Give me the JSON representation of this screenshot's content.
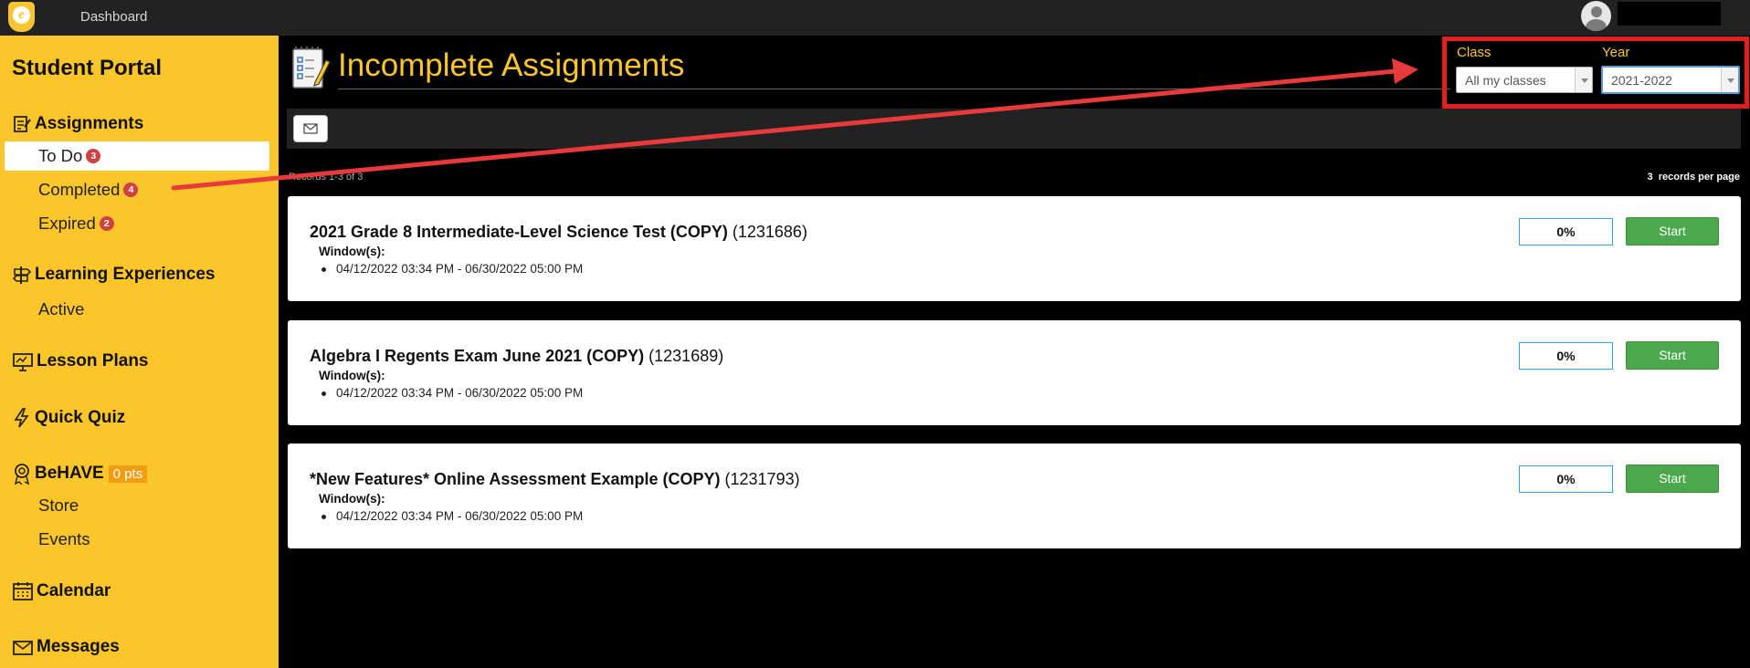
{
  "topbar": {
    "nav_label": "Dashboard"
  },
  "sidebar": {
    "title": "Student Portal",
    "sections": [
      {
        "label": "Assignments",
        "icon": "assignments-icon",
        "items": [
          {
            "label": "To Do",
            "badge": "3"
          },
          {
            "label": "Completed",
            "badge": "4"
          },
          {
            "label": "Expired",
            "badge": "2"
          }
        ]
      },
      {
        "label": "Learning Experiences",
        "icon": "signpost-icon",
        "items": [
          {
            "label": "Active"
          }
        ]
      },
      {
        "label": "Lesson Plans",
        "icon": "presentation-icon"
      },
      {
        "label": "Quick Quiz",
        "icon": "lightning-icon"
      },
      {
        "label": "BeHAVE",
        "icon": "award-icon",
        "pts": "0 pts",
        "items": [
          {
            "label": "Store"
          },
          {
            "label": "Events"
          }
        ]
      },
      {
        "label": "Calendar",
        "icon": "calendar-icon"
      },
      {
        "label": "Messages",
        "icon": "envelope-icon"
      }
    ]
  },
  "main": {
    "title": "Incomplete Assignments",
    "filters": {
      "class_label": "Class",
      "class_value": "All my classes",
      "year_label": "Year",
      "year_value": "2021-2022"
    },
    "records_text": "Records 1-3 of 3",
    "per_page": {
      "count": "3",
      "label": "records per page"
    },
    "window_label": "Window(s):",
    "start_label": "Start",
    "assignments": [
      {
        "title": "2021 Grade 8 Intermediate-Level Science Test (COPY)",
        "id": "(1231686)",
        "window": "04/12/2022 03:34 PM - 06/30/2022 05:00 PM",
        "progress": "0%"
      },
      {
        "title": "Algebra I Regents Exam June 2021 (COPY)",
        "id": "(1231689)",
        "window": "04/12/2022 03:34 PM - 06/30/2022 05:00 PM",
        "progress": "0%"
      },
      {
        "title": "*New Features* Online Assessment Example (COPY)",
        "id": "(1231793)",
        "window": "04/12/2022 03:34 PM - 06/30/2022 05:00 PM",
        "progress": "0%"
      }
    ]
  },
  "colors": {
    "brand_yellow": "#fcc62b",
    "annotation_red": "#e21f1f",
    "start_green": "#4ca84c"
  }
}
